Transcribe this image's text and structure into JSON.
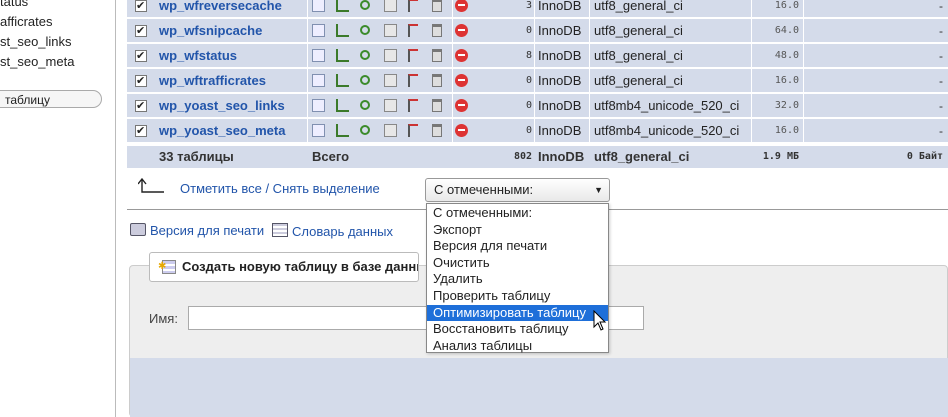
{
  "leftnav": {
    "items": [
      "tatus",
      "afficrates",
      "st_seo_links",
      "st_seo_meta"
    ],
    "filter_label": "таблицу"
  },
  "tables": [
    {
      "name": "wp_wfreversecache",
      "rows": "3",
      "engine": "InnoDB",
      "collation": "utf8_general_ci",
      "size": "16.0 КБ",
      "overhead": "-"
    },
    {
      "name": "wp_wfsnipcache",
      "rows": "0",
      "engine": "InnoDB",
      "collation": "utf8_general_ci",
      "size": "64.0 КБ",
      "overhead": "-"
    },
    {
      "name": "wp_wfstatus",
      "rows": "8",
      "engine": "InnoDB",
      "collation": "utf8_general_ci",
      "size": "48.0 КБ",
      "overhead": "-"
    },
    {
      "name": "wp_wftrafficrates",
      "rows": "0",
      "engine": "InnoDB",
      "collation": "utf8_general_ci",
      "size": "16.0 КБ",
      "overhead": "-"
    },
    {
      "name": "wp_yoast_seo_links",
      "rows": "0",
      "engine": "InnoDB",
      "collation": "utf8mb4_unicode_520_ci",
      "size": "32.0 КБ",
      "overhead": "-"
    },
    {
      "name": "wp_yoast_seo_meta",
      "rows": "0",
      "engine": "InnoDB",
      "collation": "utf8mb4_unicode_520_ci",
      "size": "16.0 КБ",
      "overhead": "-"
    }
  ],
  "summary": {
    "count": "33 таблицы",
    "label": "Всего",
    "rows": "802",
    "engine": "InnoDB",
    "collation": "utf8_general_ci",
    "size": "1.9 МБ",
    "overhead": "0 Байт"
  },
  "bulk": {
    "check_all": "Отметить все / Снять выделение",
    "select_value": "С отмеченными:",
    "options": [
      "С отмеченными:",
      "Экспорт",
      "Версия для печати",
      "Очистить",
      "Удалить",
      "Проверить таблицу",
      "Оптимизировать таблицу",
      "Восстановить таблицу",
      "Анализ таблицы"
    ],
    "highlighted_index": 6
  },
  "links": {
    "print": "Версия для печати",
    "dictionary": "Словарь данных"
  },
  "create": {
    "legend": "Создать новую таблицу в базе данных",
    "name_label": "Имя:",
    "name_value": ""
  }
}
